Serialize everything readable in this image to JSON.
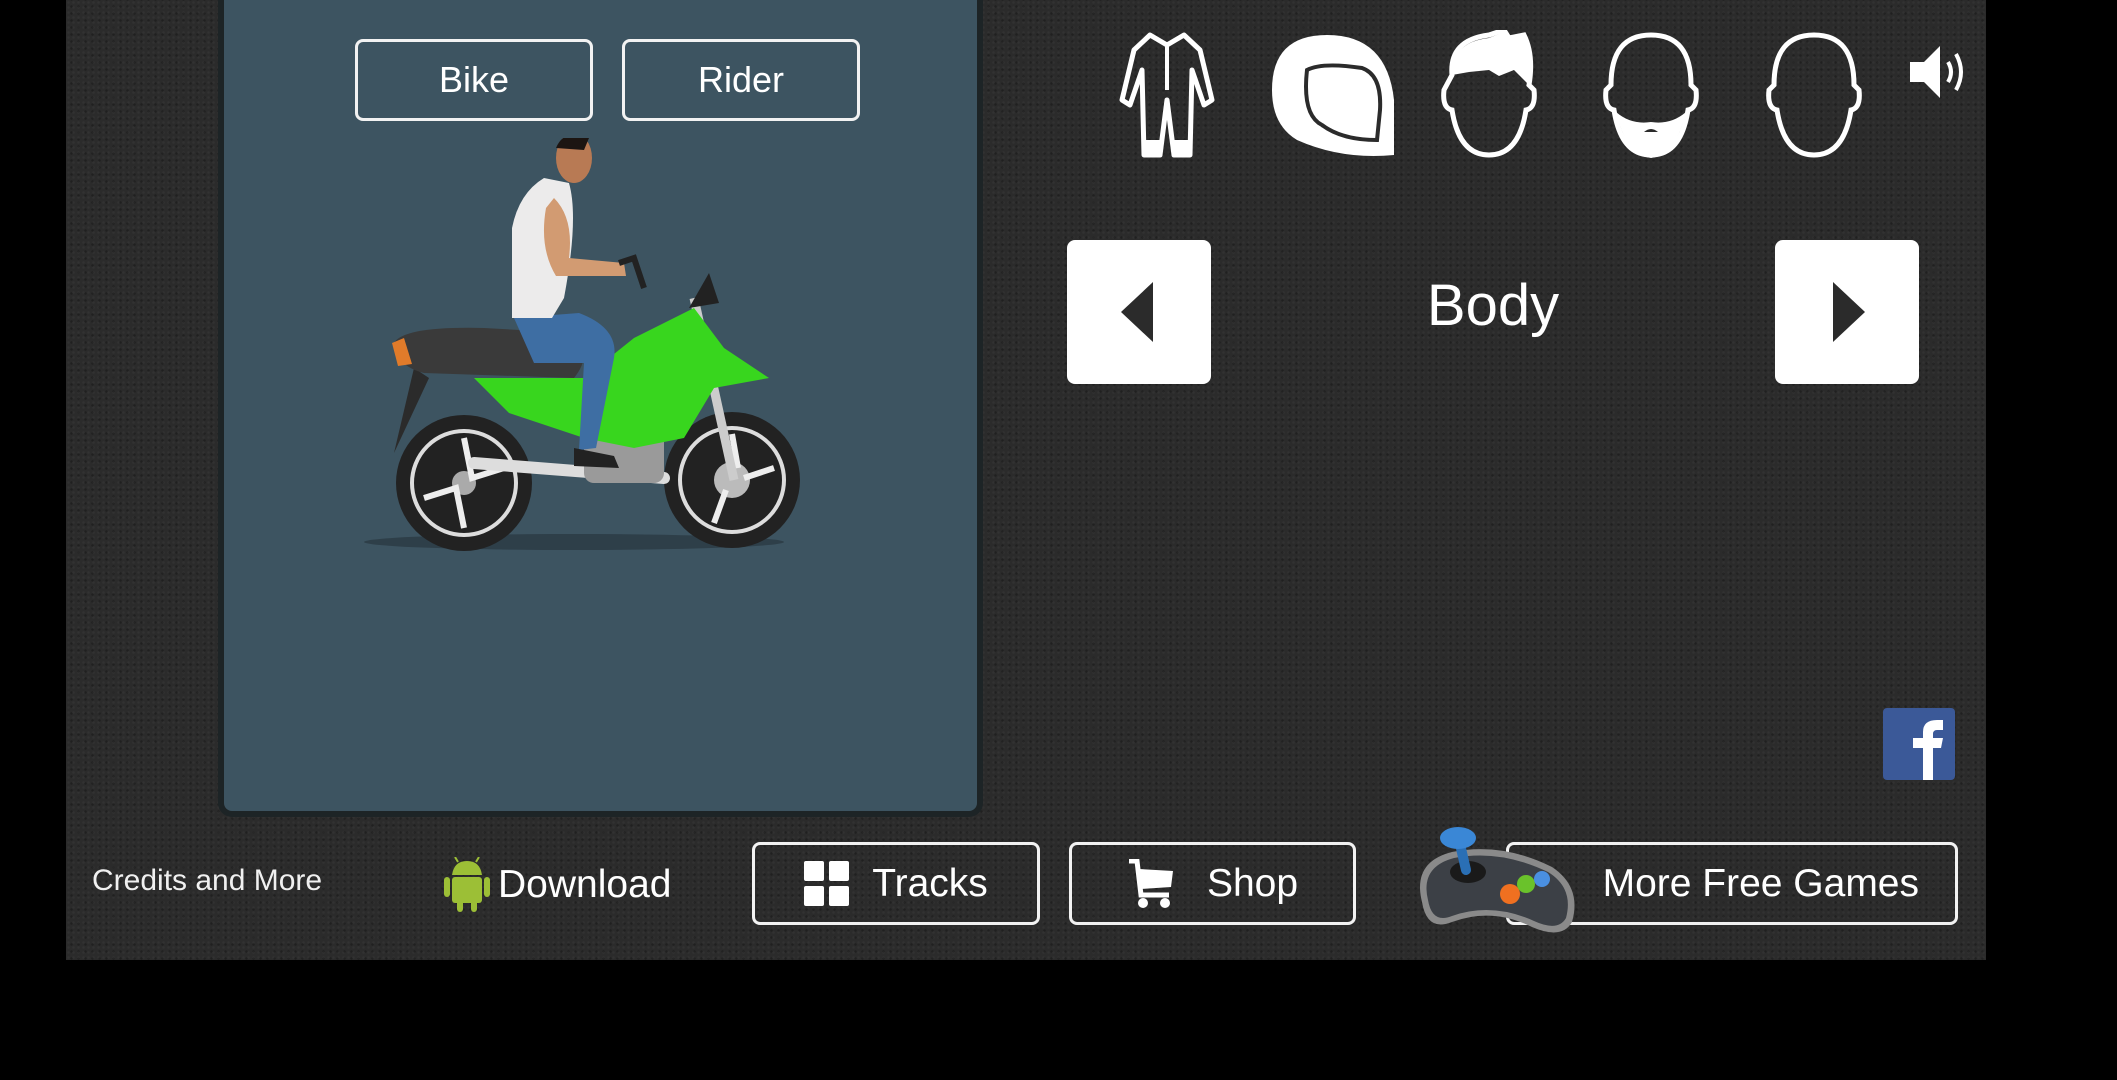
{
  "preview_panel": {
    "tabs": [
      {
        "label": "Bike"
      },
      {
        "label": "Rider"
      }
    ],
    "preview_image": "rider-on-green-motorcycle"
  },
  "customize": {
    "category_icons": [
      {
        "name": "suit-icon"
      },
      {
        "name": "helmet-icon"
      },
      {
        "name": "hair-icon"
      },
      {
        "name": "beard-icon"
      },
      {
        "name": "face-icon"
      }
    ],
    "sound_icon": "speaker-icon",
    "current_category": "Body",
    "prev_icon": "triangle-left",
    "next_icon": "triangle-right"
  },
  "social": {
    "facebook_icon": "f"
  },
  "bottom_bar": {
    "credits_label": "Credits and More",
    "download_label": "Download",
    "tracks_label": "Tracks",
    "shop_label": "Shop",
    "more_games_label": "More Free Games"
  },
  "colors": {
    "panel": "#3d5461",
    "background": "#2b2b2b",
    "facebook": "#3b5998",
    "android": "#9cbf36",
    "bike_green": "#38d61e"
  }
}
